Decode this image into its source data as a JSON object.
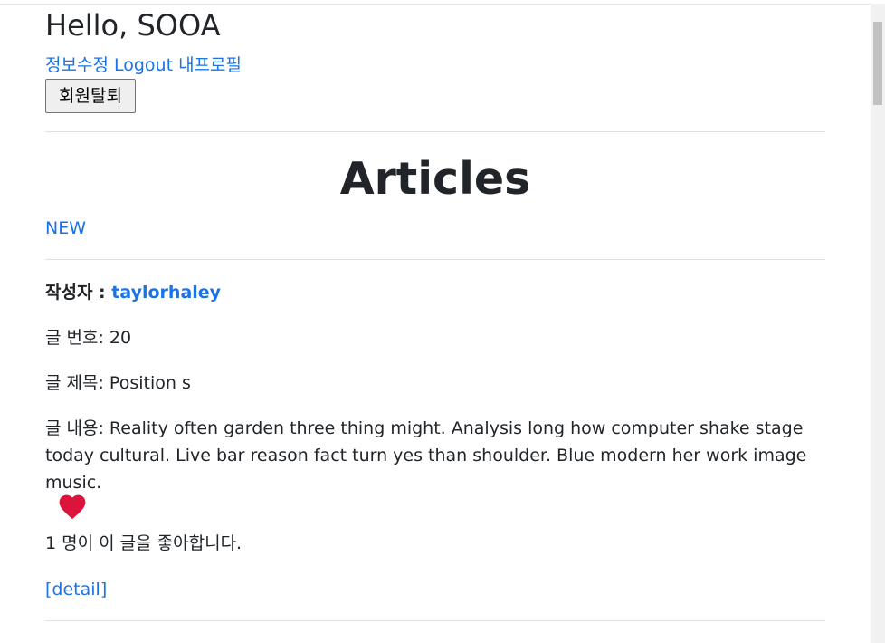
{
  "header": {
    "greeting": "Hello, SOOA",
    "links": {
      "edit_profile": "정보수정",
      "logout": "Logout",
      "my_profile": "내프로필"
    },
    "withdraw_button": "회원탈퇴"
  },
  "page": {
    "title": "Articles",
    "new_link": "NEW"
  },
  "article": {
    "author_label": "작성자 : ",
    "author": "taylorhaley",
    "number_label": "글 번호: ",
    "number": "20",
    "title_label": "글 제목: ",
    "title": "Position s",
    "content_label": "글 내용: ",
    "content": "Reality often garden three thing might. Analysis long how computer shake stage today cultural. Live bar reason fact turn yes than shoulder. Blue modern her work image music.",
    "like_icon": "heart-icon",
    "like_color": "#dc143c",
    "likes_text": "1 명이 이 글을 좋아합니다.",
    "detail_link": "[detail]"
  },
  "colors": {
    "link": "#1a73e8",
    "text": "#212529",
    "divider": "#dee2e6"
  }
}
